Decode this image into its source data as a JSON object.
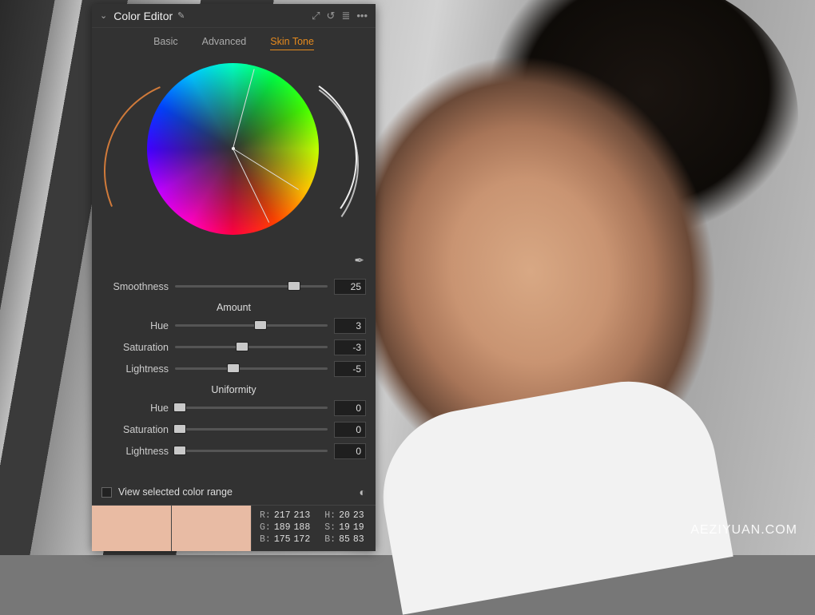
{
  "watermark": "AEZIYUAN.COM",
  "panel": {
    "title": "Color Editor",
    "tabs": {
      "basic": "Basic",
      "advanced": "Advanced",
      "skin": "Skin Tone",
      "active": "skin"
    },
    "smoothness": {
      "label": "Smoothness",
      "value": "25",
      "pct": 78
    },
    "amount": {
      "label": "Amount",
      "hue": {
        "label": "Hue",
        "value": "3",
        "pct": 56
      },
      "saturation": {
        "label": "Saturation",
        "value": "-3",
        "pct": 44
      },
      "lightness": {
        "label": "Lightness",
        "value": "-5",
        "pct": 38
      }
    },
    "uniformity": {
      "label": "Uniformity",
      "hue": {
        "label": "Hue",
        "value": "0",
        "pct": 3
      },
      "saturation": {
        "label": "Saturation",
        "value": "0",
        "pct": 3
      },
      "lightness": {
        "label": "Lightness",
        "value": "0",
        "pct": 3
      }
    },
    "view_range": "View selected color range",
    "swatches": {
      "a": "#e9bba3",
      "b": "#e8bba4"
    },
    "readout": {
      "r": {
        "label": "R:",
        "a": "217",
        "b": "213"
      },
      "g": {
        "label": "G:",
        "a": "189",
        "b": "188"
      },
      "bl": {
        "label": "B:",
        "a": "175",
        "b": "172"
      },
      "h": {
        "label": "H:",
        "a": "20",
        "b": "23"
      },
      "s": {
        "label": "S:",
        "a": "19",
        "b": "19"
      },
      "v": {
        "label": "B:",
        "a": "85",
        "b": "83"
      }
    }
  }
}
